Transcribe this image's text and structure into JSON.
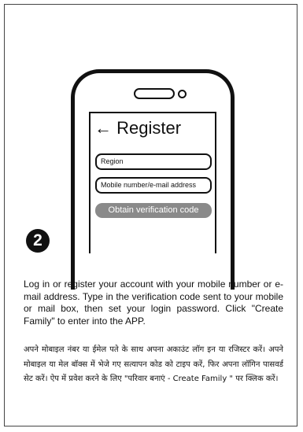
{
  "register_screen": {
    "title": "← Register",
    "region_field": "Region",
    "mobile_field": "Mobile number/e-mail address",
    "obtain_button": "Obtain verification code"
  },
  "step": {
    "number": "2"
  },
  "instructions": {
    "english": "Log in or register your account with your mobile number or e-mail address. Type in the verification code sent to your mobile or mail box, then set your login password. Click \"Create Family\" to enter into the APP.",
    "hindi": "अपने मोबाइल नंबर या ईमेल पते के साथ अपना अकाउंट लॉग इन या रजिस्टर करें। अपने मोबाइल या मेल बॉक्स में भेजे गए सत्यापन कोड को टाइप करें, फिर अपना लॉगिन पासवर्ड सेट करें। ऐप में प्रवेश करने के लिए \"परिवार बनाएं - Create Family \" पर क्लिक करें।"
  }
}
